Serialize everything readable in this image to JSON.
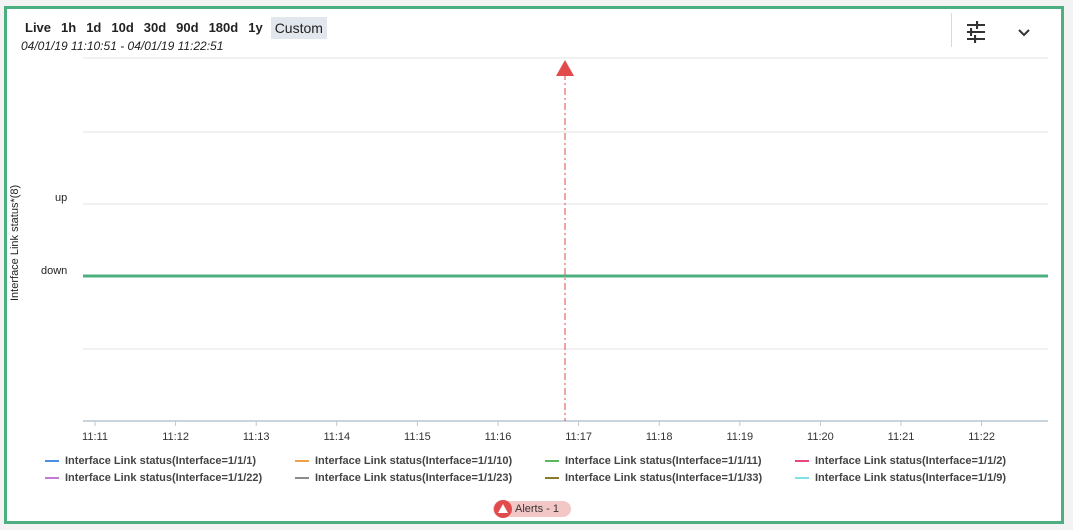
{
  "toolbar": {
    "ranges": [
      "Live",
      "1h",
      "1d",
      "10d",
      "30d",
      "90d",
      "180d",
      "1y"
    ],
    "custom_label": "Custom",
    "date_range": "04/01/19 11:10:51 - 04/01/19 11:22:51"
  },
  "chart_data": {
    "type": "line",
    "ylabel": "Interface Link status*(8)",
    "y_categories": [
      "down",
      "up"
    ],
    "x_ticks": [
      "11:11",
      "11:12",
      "11:13",
      "11:14",
      "11:15",
      "11:16",
      "11:17",
      "11:18",
      "11:19",
      "11:20",
      "11:21",
      "11:22"
    ],
    "series": [
      {
        "name": "Interface Link status(Interface=1/1/1)",
        "color": "#4a90e2",
        "value": "down"
      },
      {
        "name": "Interface Link status(Interface=1/1/10)",
        "color": "#f0a04b",
        "value": "down"
      },
      {
        "name": "Interface Link status(Interface=1/1/11)",
        "color": "#5cb85c",
        "value": "down"
      },
      {
        "name": "Interface Link status(Interface=1/1/2)",
        "color": "#e8457a",
        "value": "down"
      },
      {
        "name": "Interface Link status(Interface=1/1/22)",
        "color": "#c27ad6",
        "value": "down"
      },
      {
        "name": "Interface Link status(Interface=1/1/23)",
        "color": "#8c8c8c",
        "value": "down"
      },
      {
        "name": "Interface Link status(Interface=1/1/33)",
        "color": "#8a7a2a",
        "value": "down"
      },
      {
        "name": "Interface Link status(Interface=1/1/9)",
        "color": "#7fe0e6",
        "value": "down"
      }
    ],
    "alert_marker_time": "11:16:50",
    "line_color": "#4caf7f",
    "alert_color": "#e24b4b"
  },
  "alerts": {
    "label": "Alerts - 1"
  }
}
